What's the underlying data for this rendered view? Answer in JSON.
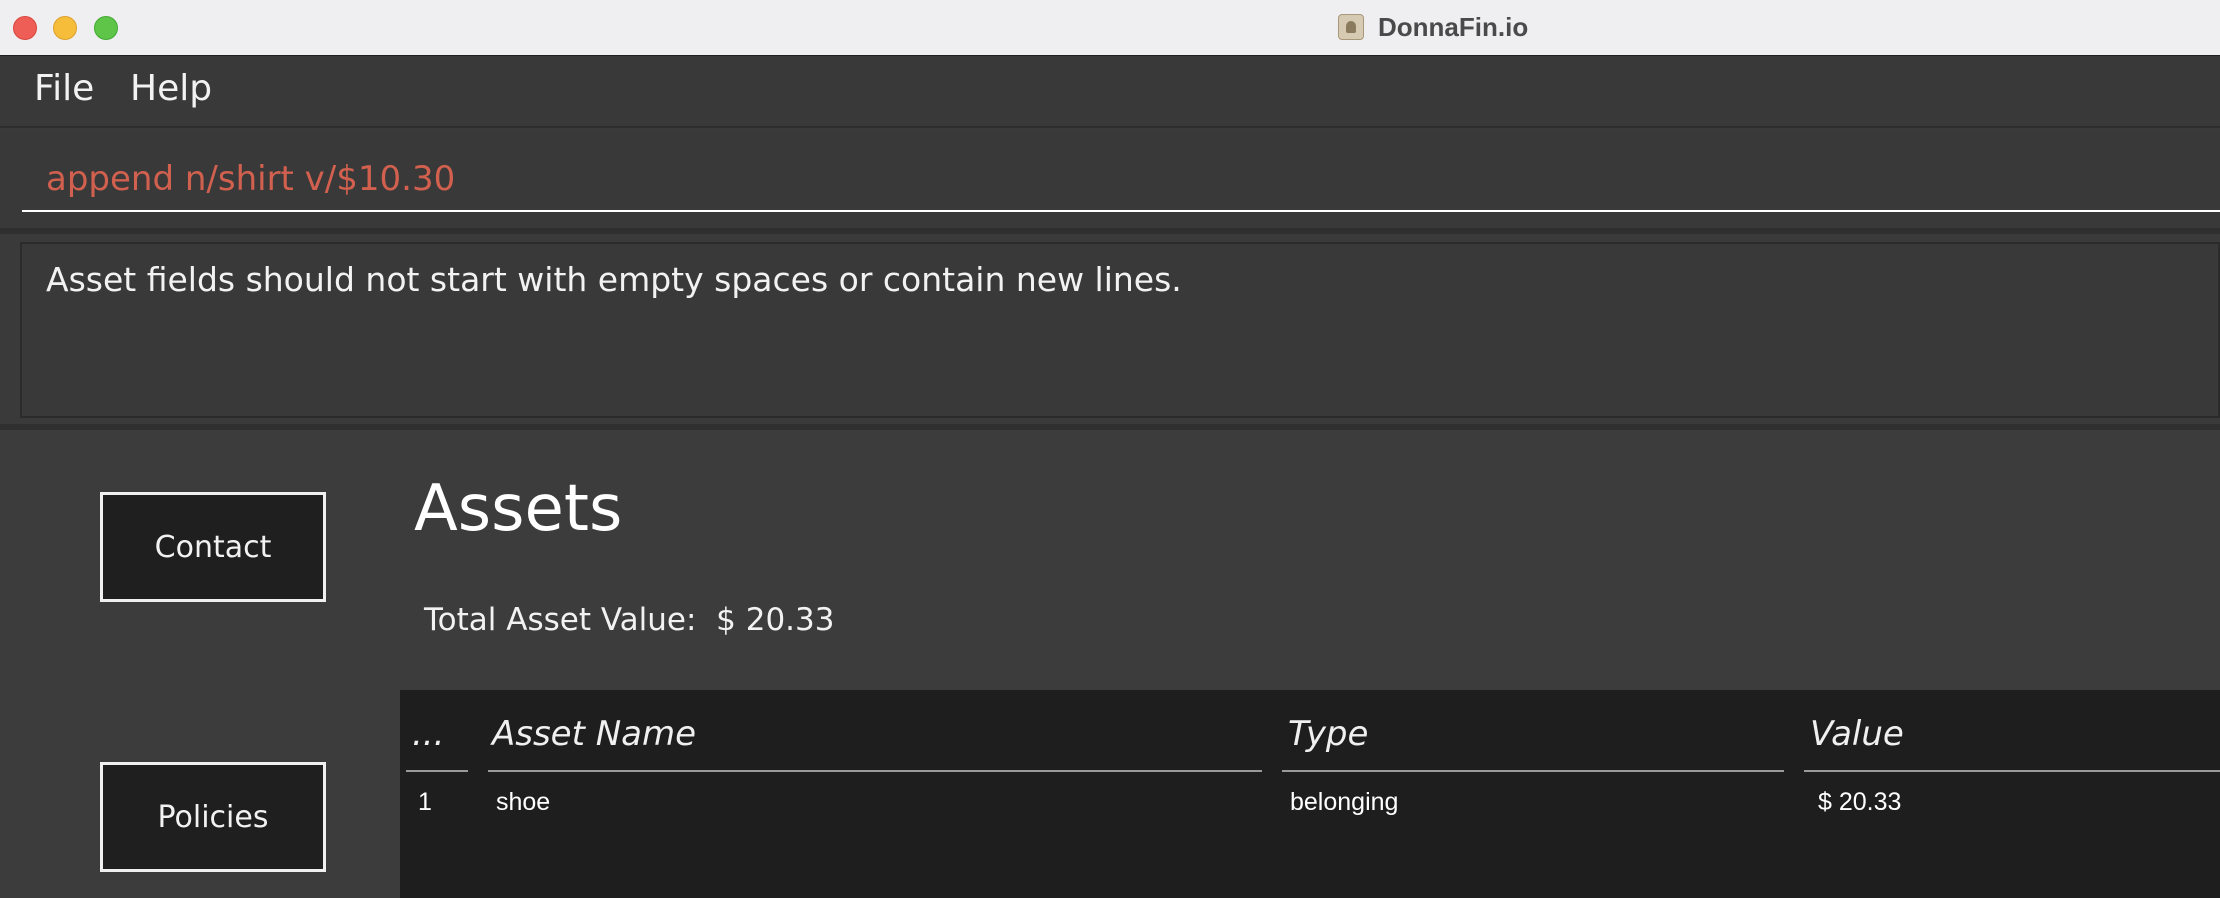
{
  "window": {
    "title": "DonnaFin.io"
  },
  "menu": {
    "items": [
      "File",
      "Help"
    ]
  },
  "command": {
    "value": "append n/shirt v/$10.30",
    "text_color": "#d2604f"
  },
  "result": {
    "message": "Asset fields should not start with empty spaces or contain new lines."
  },
  "sidebar": {
    "buttons": [
      "Contact",
      "Policies"
    ]
  },
  "assets": {
    "title": "Assets",
    "total_label": "Total Asset Value:",
    "total_value": "$ 20.33",
    "columns": [
      "...",
      "Asset Name",
      "Type",
      "Value"
    ],
    "rows": [
      {
        "index": "1",
        "name": "shoe",
        "type": "belonging",
        "value": "$ 20.33"
      }
    ]
  },
  "colors": {
    "background": "#3a3a3a",
    "table_background": "#1e1e1e",
    "button_background": "#1f1f1f"
  }
}
